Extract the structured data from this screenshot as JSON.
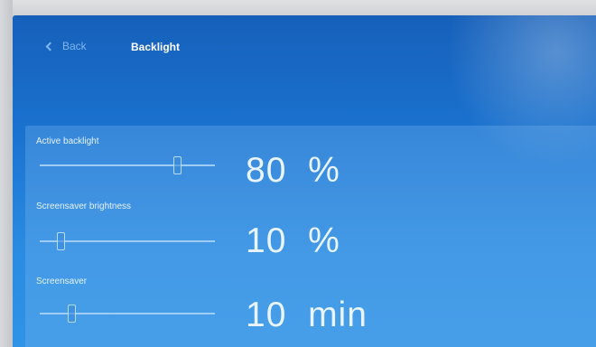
{
  "header": {
    "back_label": "Back",
    "title": "Backlight"
  },
  "settings": [
    {
      "label": "Active backlight",
      "value": "80",
      "unit": "%",
      "level": 0.8
    },
    {
      "label": "Screensaver brightness",
      "value": "10",
      "unit": "%",
      "level": 0.1
    },
    {
      "label": "Screensaver",
      "value": "10",
      "unit": "min",
      "level": 0.17
    }
  ],
  "colors": {
    "background": "#1a72cf",
    "accent_text": "#7fb6ee"
  },
  "icons": {
    "back": "chevron-left-icon"
  }
}
